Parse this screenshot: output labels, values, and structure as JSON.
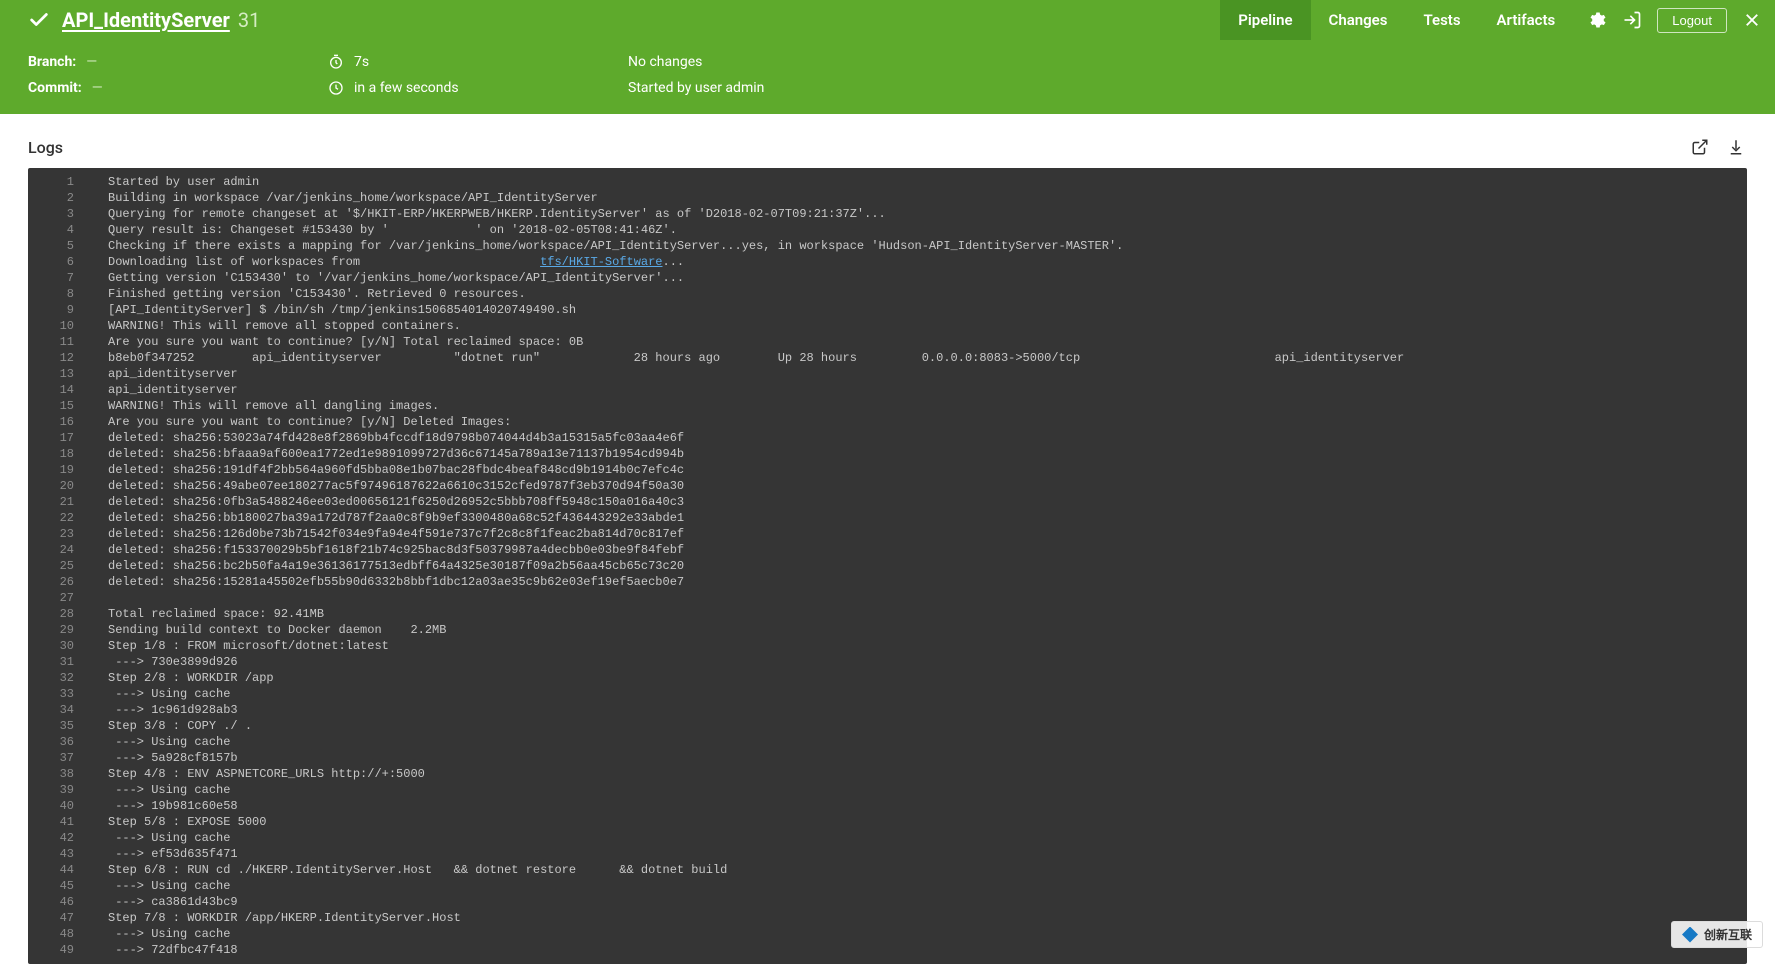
{
  "header": {
    "title": "API_IdentityServer",
    "run_number": "31",
    "tabs": [
      {
        "label": "Pipeline",
        "active": true
      },
      {
        "label": "Changes",
        "active": false
      },
      {
        "label": "Tests",
        "active": false
      },
      {
        "label": "Artifacts",
        "active": false
      }
    ],
    "logout_label": "Logout"
  },
  "meta": {
    "branch_label": "Branch:",
    "branch_value": "—",
    "commit_label": "Commit:",
    "commit_value": "—",
    "duration": "7s",
    "eta": "in a few seconds",
    "changes": "No changes",
    "started_by": "Started by user admin"
  },
  "logs": {
    "title": "Logs",
    "tfs_link": "tfs/HKIT-Software",
    "lines": [
      "Started by user admin",
      "Building in workspace /var/jenkins_home/workspace/API_IdentityServer",
      "Querying for remote changeset at '$/HKIT-ERP/HKERPWEB/HKERP.IdentityServer' as of 'D2018-02-07T09:21:37Z'...",
      "Query result is: Changeset #153430 by '            ' on '2018-02-05T08:41:46Z'.",
      "Checking if there exists a mapping for /var/jenkins_home/workspace/API_IdentityServer...yes, in workspace 'Hudson-API_IdentityServer-MASTER'.",
      "Downloading list of workspaces from                         tfs/HKIT-Software...",
      "Getting version 'C153430' to '/var/jenkins_home/workspace/API_IdentityServer'...",
      "Finished getting version 'C153430'. Retrieved 0 resources.",
      "[API_IdentityServer] $ /bin/sh /tmp/jenkins1506854014020749490.sh",
      "WARNING! This will remove all stopped containers.",
      "Are you sure you want to continue? [y/N] Total reclaimed space: 0B",
      "b8eb0f347252        api_identityserver          \"dotnet run\"             28 hours ago        Up 28 hours         0.0.0.0:8083->5000/tcp                           api_identityserver",
      "api_identityserver",
      "api_identityserver",
      "WARNING! This will remove all dangling images.",
      "Are you sure you want to continue? [y/N] Deleted Images:",
      "deleted: sha256:53023a74fd428e8f2869bb4fccdf18d9798b074044d4b3a15315a5fc03aa4e6f",
      "deleted: sha256:bfaaa9af600ea1772ed1e9891099727d36c67145a789a13e71137b1954cd994b",
      "deleted: sha256:191df4f2bb564a960fd5bba08e1b07bac28fbdc4beaf848cd9b1914b0c7efc4c",
      "deleted: sha256:49abe07ee180277ac5f97496187622a6610c3152cfed9787f3eb370d94f50a30",
      "deleted: sha256:0fb3a5488246ee03ed00656121f6250d26952c5bbb708ff5948c150a016a40c3",
      "deleted: sha256:bb180027ba39a172d787f2aa0c8f9b9ef3300480a68c52f436443292e33abde1",
      "deleted: sha256:126d0be73b71542f034e9fa94e4f591e737c7f2c8c8f1feac2ba814d70c817ef",
      "deleted: sha256:f153370029b5bf1618f21b74c925bac8d3f50379987a4decbb0e03be9f84febf",
      "deleted: sha256:bc2b50fa4a19e36136177513edbff64a4325e30187f09a2b56aa45cb65c73c20",
      "deleted: sha256:15281a45502efb55b90d6332b8bbf1dbc12a03ae35c9b62e03ef19ef5aecb0e7",
      "",
      "Total reclaimed space: 92.41MB",
      "Sending build context to Docker daemon    2.2MB",
      "Step 1/8 : FROM microsoft/dotnet:latest",
      " ---> 730e3899d926",
      "Step 2/8 : WORKDIR /app",
      " ---> Using cache",
      " ---> 1c961d928ab3",
      "Step 3/8 : COPY ./ .",
      " ---> Using cache",
      " ---> 5a928cf8157b",
      "Step 4/8 : ENV ASPNETCORE_URLS http://+:5000",
      " ---> Using cache",
      " ---> 19b981c60e58",
      "Step 5/8 : EXPOSE 5000",
      " ---> Using cache",
      " ---> ef53d635f471",
      "Step 6/8 : RUN cd ./HKERP.IdentityServer.Host   && dotnet restore      && dotnet build",
      " ---> Using cache",
      " ---> ca3861d43bc9",
      "Step 7/8 : WORKDIR /app/HKERP.IdentityServer.Host",
      " ---> Using cache",
      " ---> 72dfbc47f418"
    ]
  },
  "watermark": "创新互联"
}
